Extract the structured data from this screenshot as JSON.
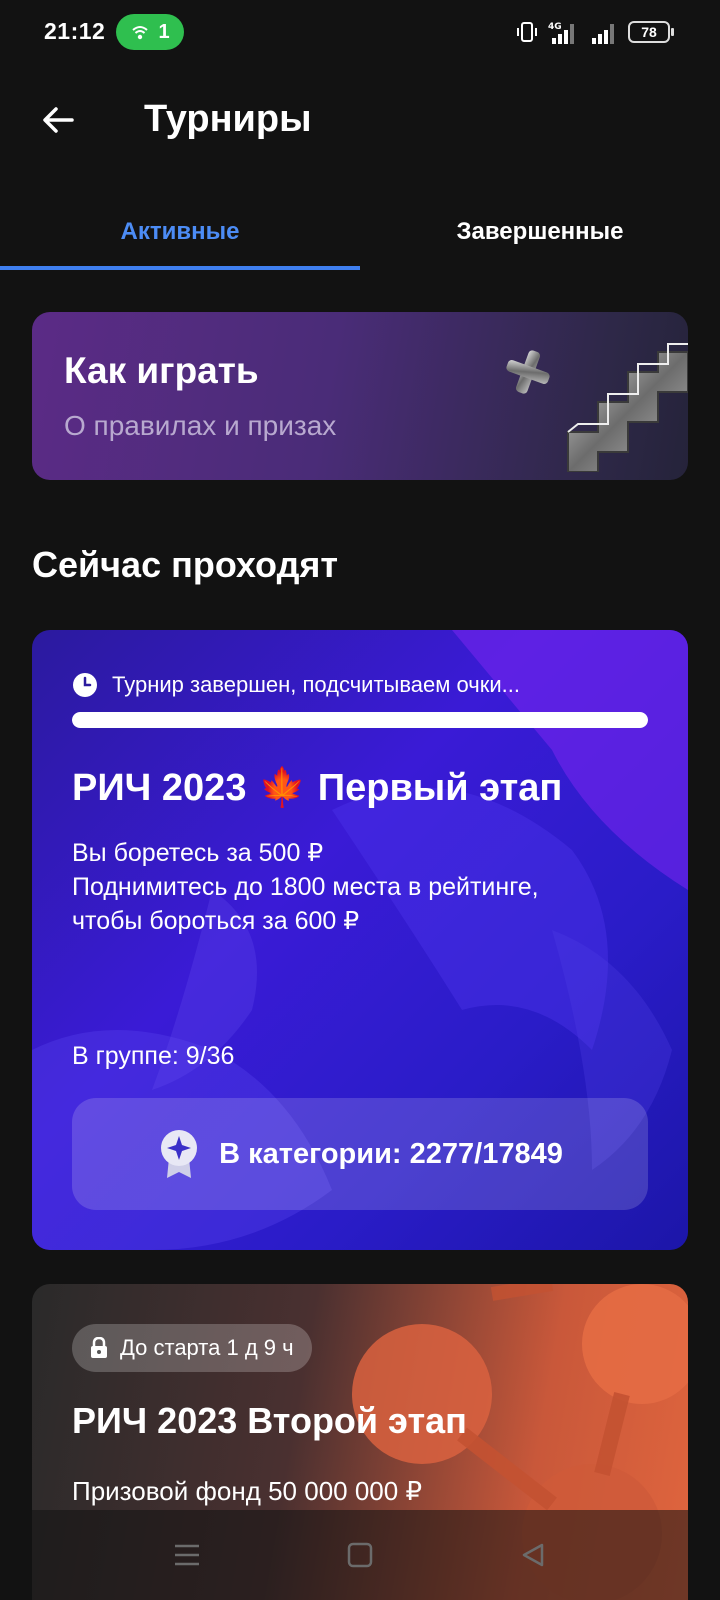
{
  "status_bar": {
    "time": "21:12",
    "hotspot_count": "1",
    "battery": "78",
    "icons": [
      "wifi-hotspot-icon",
      "vibrate-icon",
      "signal-4g-icon",
      "signal-icon",
      "battery-icon"
    ]
  },
  "header": {
    "title": "Турниры",
    "back_icon": "arrow-left-icon"
  },
  "tabs": [
    {
      "label": "Активные",
      "active": true
    },
    {
      "label": "Завершенные",
      "active": false
    }
  ],
  "how_to_play": {
    "title": "Как играть",
    "subtitle": "О правилах и призах"
  },
  "section_title": "Сейчас проходят",
  "tournaments": [
    {
      "status": "Турнир завершен, подсчитываем очки...",
      "progress": 1.0,
      "title_part1": "РИЧ 2023",
      "title_emoji": "🍁",
      "title_part2": "Первый этап",
      "desc_line1": "Вы боретесь за 500 ₽",
      "desc_line2": "Поднимитесь до 1800 места в рейтинге,",
      "desc_line3": "чтобы бороться за 600 ₽",
      "group": "В группе: 9/36",
      "category": "В категории: 2277/17849",
      "accent": "#3a1bd6"
    },
    {
      "badge": "До старта 1 д 9 ч",
      "title": "РИЧ 2023 Второй этап",
      "prize": "Призовой фонд 50 000 000 ₽",
      "accent": "#e0653e"
    }
  ],
  "nav_bar": {
    "icons": [
      "menu-icon",
      "home-square-icon",
      "back-triangle-icon"
    ]
  }
}
